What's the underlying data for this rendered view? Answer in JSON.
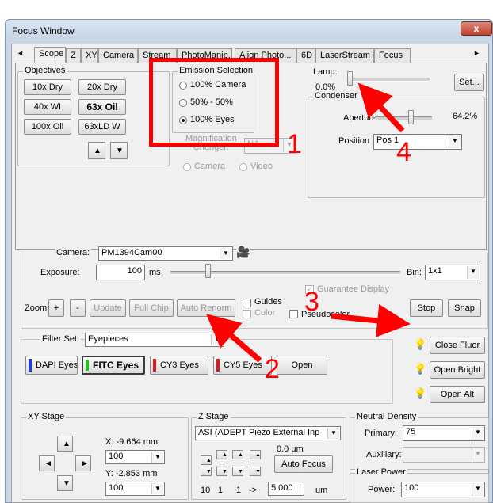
{
  "window": {
    "title": "Focus Window",
    "close_label": "x"
  },
  "tabs": [
    {
      "label": "Scope",
      "active": true
    },
    {
      "label": "Z"
    },
    {
      "label": "XY"
    },
    {
      "label": "Camera"
    },
    {
      "label": "Stream"
    },
    {
      "label": "PhotoManip..."
    },
    {
      "label": "Align Photo..."
    },
    {
      "label": "6D"
    },
    {
      "label": "LaserStream"
    },
    {
      "label": "Focus"
    }
  ],
  "tab_scroll": {
    "left": "◄",
    "right": "►"
  },
  "objectives": {
    "title": "Objectives",
    "buttons": [
      "10x Dry",
      "20x Dry",
      "40x WI",
      "63x Oil",
      "100x Oil",
      "63xLD W"
    ],
    "selected": "63x Oil",
    "up": "▲",
    "down": "▼"
  },
  "emission": {
    "title": "Emission Selection",
    "options": [
      "100% Camera",
      "50% - 50%",
      "100% Eyes"
    ],
    "selected": "100% Eyes"
  },
  "magnification": {
    "label_line1": "Magnification",
    "label_line2": "Changer:",
    "value": "NA",
    "radio_camera": "Camera",
    "radio_video": "Video"
  },
  "lamp": {
    "label": "Lamp:",
    "value": "0.0%",
    "level": 0.0,
    "set_label": "Set..."
  },
  "condenser": {
    "title": "Condenser",
    "aperture_label": "Aperture",
    "aperture_value": "64.2%",
    "aperture_level": 0.642,
    "position_label": "Position",
    "position_value": "Pos 1"
  },
  "camera": {
    "label": "Camera:",
    "value": "PM1394Cam00",
    "exposure_label": "Exposure:",
    "exposure_value": "100",
    "exposure_unit": "ms",
    "bin_label": "Bin:",
    "bin_value": "1x1",
    "guarantee_display": "Guarantee Display",
    "zoom_label": "Zoom:",
    "zoom_plus": "+",
    "zoom_minus": "-",
    "update": "Update",
    "full_chip": "Full Chip",
    "auto_renorm": "Auto Renorm",
    "guides": "Guides",
    "color": "Color",
    "pseudocolor": "Pseudocolor",
    "stop": "Stop",
    "snap": "Snap"
  },
  "filter": {
    "label": "Filter Set:",
    "value": "Eyepieces",
    "buttons": [
      {
        "label": "DAPI Eyes",
        "color": "#1f3fd8"
      },
      {
        "label": "FITC Eyes",
        "color": "#22c022",
        "selected": true
      },
      {
        "label": "CY3 Eyes",
        "color": "#d81c1c"
      },
      {
        "label": "CY5 Eyes",
        "color": "#d81c1c"
      }
    ],
    "open": "Open"
  },
  "fluor": {
    "close_fluor": "Close Fluor",
    "open_bright": "Open Bright",
    "open_alt": "Open Alt"
  },
  "xy_stage": {
    "title": "XY Stage",
    "x_label": "X: -9.664 mm",
    "x_step": "100",
    "y_label": "Y: -2.853 mm",
    "y_step": "100"
  },
  "z_stage": {
    "title": "Z Stage",
    "device": "ASI (ADEPT Piezo External Inp",
    "position": "0.0 µm",
    "auto_focus": "Auto Focus",
    "steps": [
      "10",
      "1",
      ".1"
    ],
    "arrow": "->",
    "step_value": "5.000",
    "step_unit": "um"
  },
  "neutral_density": {
    "title": "Neutral Density",
    "primary_label": "Primary:",
    "primary_value": "75",
    "auxiliary_label": "Auxiliary:",
    "auxiliary_value": ""
  },
  "laser_power": {
    "title": "Laser Power",
    "power_label": "Power:",
    "power_value": "100"
  },
  "annotations": {
    "color": "#ff0000",
    "n1": "1",
    "n2": "2",
    "n3": "3",
    "n4": "4"
  },
  "icons": {
    "camera": "camera-icon",
    "bulb": "lightbulb-icon"
  }
}
